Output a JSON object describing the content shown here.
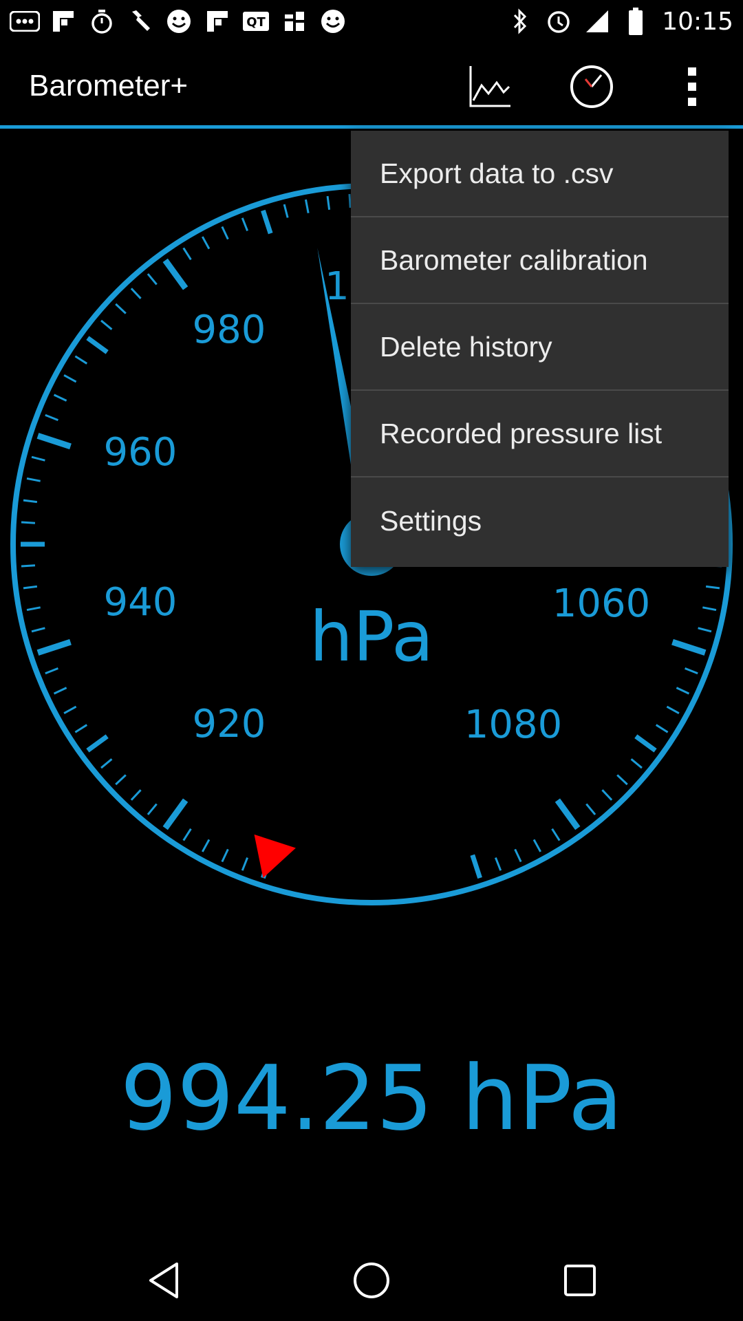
{
  "status_bar": {
    "time": "10:15",
    "left_icons": [
      "more-notifications-icon",
      "flipboard-icon",
      "stopwatch-icon",
      "wrench-icon",
      "smiley-icon",
      "flipboard-icon",
      "qt-icon",
      "app-icon",
      "smiley-icon"
    ],
    "right_icons": [
      "bluetooth-icon",
      "alarm-icon",
      "signal-icon",
      "battery-icon"
    ]
  },
  "app_bar": {
    "title": "Barometer+",
    "actions": [
      "chart-icon",
      "gauge-icon",
      "overflow-menu-icon"
    ],
    "accent_color": "#1a9bd7"
  },
  "gauge": {
    "labels": [
      "980",
      "960",
      "940",
      "920",
      "1",
      "1060",
      "1080"
    ],
    "unit": "hPa",
    "needle_value": 994.25,
    "marker_value": 910,
    "scale_min": 900,
    "scale_max": 1100,
    "needle_color": "#1a9bd7",
    "marker_color": "#ff0000"
  },
  "reading": {
    "value": "994.25 hPa"
  },
  "menu": {
    "items": [
      {
        "label": "Export data to .csv"
      },
      {
        "label": "Barometer calibration"
      },
      {
        "label": "Delete history"
      },
      {
        "label": "Recorded pressure list"
      },
      {
        "label": "Settings"
      }
    ]
  },
  "nav_bar": {
    "buttons": [
      "back-icon",
      "home-icon",
      "recents-icon"
    ]
  }
}
